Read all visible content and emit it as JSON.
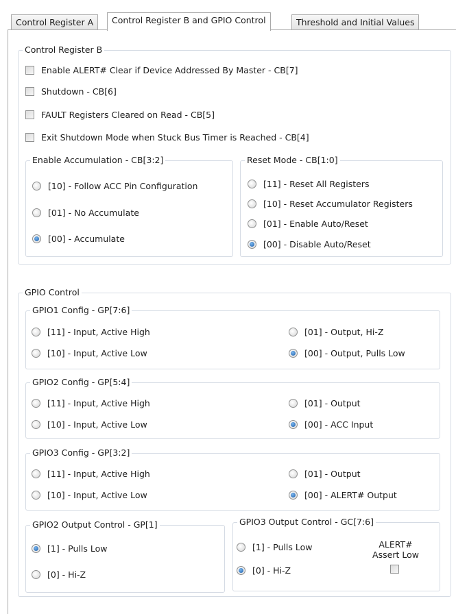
{
  "tabs": {
    "a": "Control Register A",
    "b": "Control Register B and GPIO Control",
    "c": "Threshold and Initial Values"
  },
  "crb": {
    "title": "Control Register B",
    "checks": [
      {
        "label": "Enable ALERT# Clear if Device Addressed By Master - CB[7]",
        "checked": false
      },
      {
        "label": "Shutdown - CB[6]",
        "checked": false
      },
      {
        "label": "FAULT Registers Cleared on Read - CB[5]",
        "checked": false
      },
      {
        "label": "Exit Shutdown Mode when Stuck Bus Timer is Reached - CB[4]",
        "checked": false
      }
    ],
    "accum": {
      "title": "Enable Accumulation - CB[3:2]",
      "options": [
        "[10] - Follow ACC Pin Configuration",
        "[01] - No Accumulate",
        "[00] - Accumulate"
      ],
      "selected": 2
    },
    "reset": {
      "title": "Reset Mode - CB[1:0]",
      "options": [
        "[11] - Reset All Registers",
        "[10] - Reset Accumulator Registers",
        "[01] - Enable Auto/Reset",
        "[00] - Disable Auto/Reset"
      ],
      "selected": 3
    }
  },
  "gpio": {
    "title": "GPIO Control",
    "gpio1": {
      "title": "GPIO1 Config - GP[7:6]",
      "options": [
        "[11] - Input, Active High",
        "[10] - Input, Active Low",
        "[01] - Output, Hi-Z",
        "[00] - Output, Pulls Low"
      ],
      "selected": 3
    },
    "gpio2": {
      "title": "GPIO2 Config - GP[5:4]",
      "options": [
        "[11] - Input, Active High",
        "[10] - Input, Active Low",
        "[01] - Output",
        "[00] - ACC Input"
      ],
      "selected": 3
    },
    "gpio3": {
      "title": "GPIO3 Config - GP[3:2]",
      "options": [
        "[11] - Input, Active High",
        "[10] - Input, Active Low",
        "[01] - Output",
        "[00] - ALERT# Output"
      ],
      "selected": 3
    },
    "gpio2_out": {
      "title": "GPIO2 Output Control - GP[1]",
      "options": [
        "[1] - Pulls Low",
        "[0] - Hi-Z"
      ],
      "selected": 0
    },
    "gpio3_out": {
      "title": "GPIO3 Output Control - GC[7:6]",
      "options": [
        "[1] - Pulls Low",
        "[0] - Hi-Z"
      ],
      "selected": 1,
      "alert_label_1": "ALERT#",
      "alert_label_2": "Assert Low",
      "alert_checked": false
    }
  }
}
